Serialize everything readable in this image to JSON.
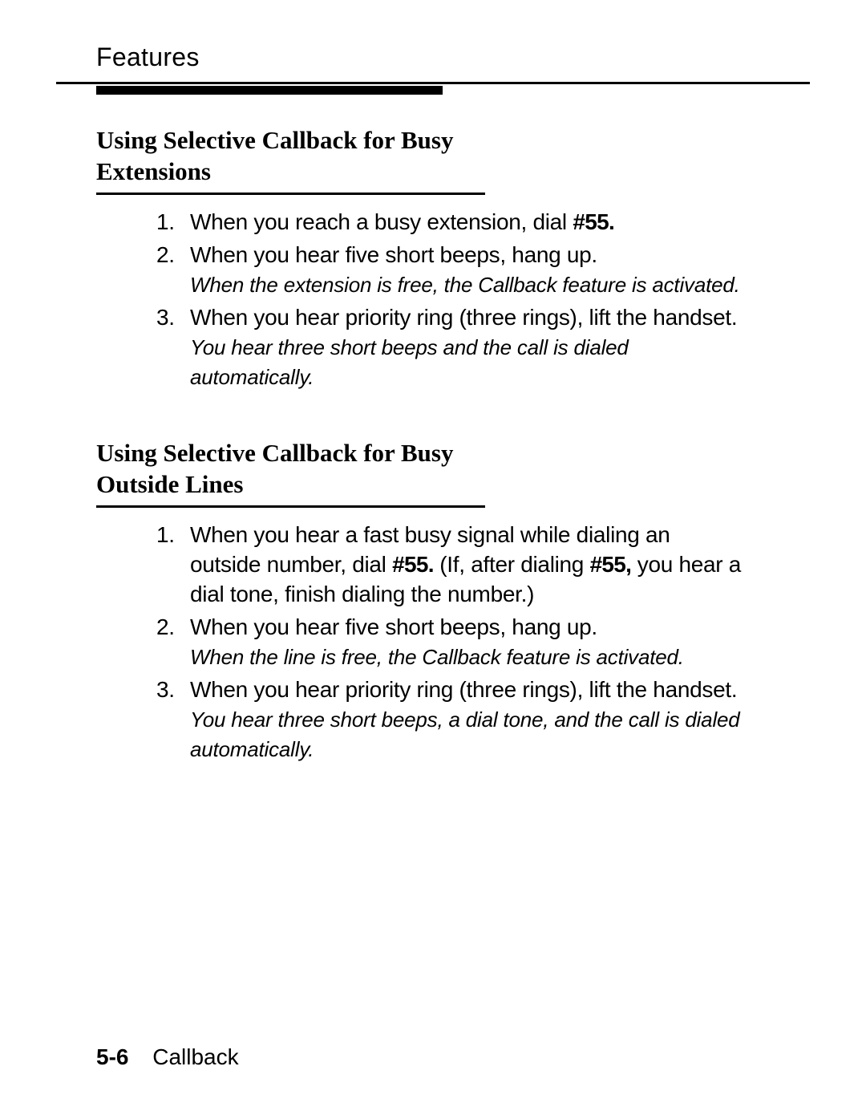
{
  "header": {
    "title": "Features"
  },
  "section1": {
    "title_line1": "Using Selective Callback for Busy",
    "title_line2": "Extensions",
    "steps": {
      "s1_num": "1.",
      "s1_a": "When you reach a busy extension, dial ",
      "s1_b": "#55.",
      "s2_num": "2.",
      "s2_a": "When you hear five short beeps, hang up.",
      "s2_note_a": "When the extension is free, the ",
      "s2_note_b": "Callback ",
      "s2_note_c": "feature is activated.",
      "s3_num": "3.",
      "s3_a": "When you hear priority ring (three rings), lift the handset.",
      "s3_note": "You hear three short beeps and the call is dialed automatically."
    }
  },
  "section2": {
    "title_line1": "Using Selective Callback for Busy",
    "title_line2": "Outside Lines",
    "steps": {
      "s1_num": "1.",
      "s1_a": "When you hear a fast busy signal while dialing an outside number, dial ",
      "s1_b": "#55.",
      "s1_c": " (If, after dialing ",
      "s1_d": "#55,",
      "s1_e": " you hear a dial tone, finish dialing the number.)",
      "s2_num": "2.",
      "s2_a": "When you hear five short beeps, hang up.",
      "s2_note": "When the line is free, the Callback feature is activated.",
      "s3_num": "3.",
      "s3_a": "When you hear priority ring (three rings), lift the handset.",
      "s3_note": "You hear three short beeps, a dial tone, and the call is dialed automatically."
    }
  },
  "footer": {
    "page": "5-6",
    "label": "Callback"
  }
}
